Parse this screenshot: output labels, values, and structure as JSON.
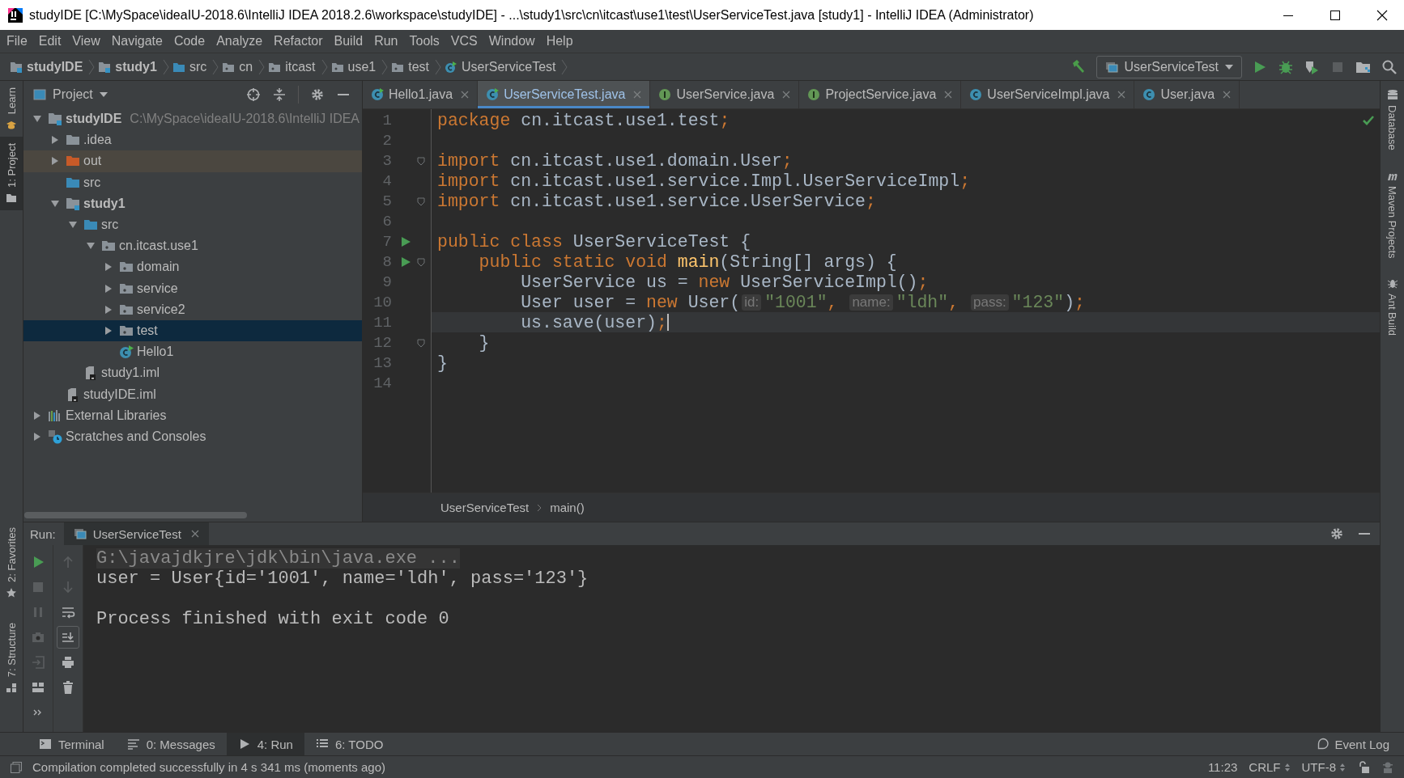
{
  "window": {
    "title": "studyIDE [C:\\MySpace\\ideaIU-2018.6\\IntelliJ IDEA 2018.2.6\\workspace\\studyIDE] - ...\\study1\\src\\cn\\itcast\\use1\\test\\UserServiceTest.java [study1] - IntelliJ IDEA (Administrator)"
  },
  "menu": [
    "File",
    "Edit",
    "View",
    "Navigate",
    "Code",
    "Analyze",
    "Refactor",
    "Build",
    "Run",
    "Tools",
    "VCS",
    "Window",
    "Help"
  ],
  "nav_bar": {
    "crumbs": [
      {
        "label": "studyIDE",
        "kind": "module"
      },
      {
        "label": "study1",
        "kind": "module"
      },
      {
        "label": "src",
        "kind": "source"
      },
      {
        "label": "cn",
        "kind": "package"
      },
      {
        "label": "itcast",
        "kind": "package"
      },
      {
        "label": "use1",
        "kind": "package"
      },
      {
        "label": "test",
        "kind": "package"
      },
      {
        "label": "UserServiceTest",
        "kind": "class-main"
      }
    ],
    "run_config": "UserServiceTest"
  },
  "left_stripe": [
    {
      "label": "Learn",
      "selected": false
    },
    {
      "label": "1: Project",
      "selected": true
    }
  ],
  "left_stripe_bottom": [
    "2: Favorites",
    "7: Structure"
  ],
  "project": {
    "title": "Project",
    "tree": [
      {
        "label": "studyIDE",
        "kind": "module",
        "bold": true,
        "hint": "C:\\MySpace\\ideaIU-2018.6\\IntelliJ IDEA",
        "expanded": true,
        "selected": false,
        "hovered": false,
        "children": [
          {
            "label": ".idea",
            "kind": "folder",
            "expanded": false,
            "selected": false,
            "hovered": false
          },
          {
            "label": "out",
            "kind": "excluded",
            "expanded": false,
            "selected": false,
            "hovered": true
          },
          {
            "label": "src",
            "kind": "source",
            "selected": false,
            "hovered": false
          },
          {
            "label": "study1",
            "kind": "module",
            "bold": true,
            "expanded": true,
            "selected": false,
            "hovered": false,
            "children": [
              {
                "label": "src",
                "kind": "source",
                "expanded": true,
                "selected": false,
                "hovered": false,
                "children": [
                  {
                    "label": "cn.itcast.use1",
                    "kind": "package",
                    "expanded": true,
                    "selected": false,
                    "hovered": false,
                    "children": [
                      {
                        "label": "domain",
                        "kind": "package",
                        "expanded": false,
                        "selected": false,
                        "hovered": false
                      },
                      {
                        "label": "service",
                        "kind": "package",
                        "expanded": false,
                        "selected": false,
                        "hovered": false
                      },
                      {
                        "label": "service2",
                        "kind": "package",
                        "expanded": false,
                        "selected": false,
                        "hovered": false
                      },
                      {
                        "label": "test",
                        "kind": "package",
                        "expanded": false,
                        "selected": true,
                        "hovered": false
                      },
                      {
                        "label": "Hello1",
                        "kind": "class-main",
                        "selected": false,
                        "hovered": false
                      }
                    ]
                  }
                ]
              },
              {
                "label": "study1.iml",
                "kind": "module-file",
                "selected": false,
                "hovered": false
              }
            ]
          },
          {
            "label": "studyIDE.iml",
            "kind": "module-file",
            "selected": false,
            "hovered": false
          }
        ]
      },
      {
        "label": "External Libraries",
        "kind": "libraries",
        "expanded": false,
        "selected": false,
        "hovered": false
      },
      {
        "label": "Scratches and Consoles",
        "kind": "scratches",
        "expanded": false,
        "selected": false,
        "hovered": false
      }
    ]
  },
  "editor": {
    "tabs": [
      {
        "label": "Hello1.java",
        "kind": "class-main",
        "selected": false
      },
      {
        "label": "UserServiceTest.java",
        "kind": "class-main",
        "selected": true
      },
      {
        "label": "UserService.java",
        "kind": "interface",
        "selected": false
      },
      {
        "label": "ProjectService.java",
        "kind": "interface",
        "selected": false
      },
      {
        "label": "UserServiceImpl.java",
        "kind": "class",
        "selected": false
      },
      {
        "label": "User.java",
        "kind": "class",
        "selected": false
      }
    ],
    "lines": [
      {
        "number": "1",
        "tokens": [
          {
            "kind": "kw",
            "text": "package"
          },
          {
            "kind": "plain",
            "text": " cn.itcast.use1.test"
          },
          {
            "kind": "kw",
            "text": ";"
          }
        ]
      },
      {
        "number": "2"
      },
      {
        "number": "3",
        "fold": true,
        "tokens": [
          {
            "kind": "kw",
            "text": "import"
          },
          {
            "kind": "plain",
            "text": " cn.itcast.use1.domain.User"
          },
          {
            "kind": "kw",
            "text": ";"
          }
        ]
      },
      {
        "number": "4",
        "tokens": [
          {
            "kind": "kw",
            "text": "import"
          },
          {
            "kind": "plain",
            "text": " cn.itcast.use1.service.Impl.UserServiceImpl"
          },
          {
            "kind": "kw",
            "text": ";"
          }
        ]
      },
      {
        "number": "5",
        "fold": true,
        "tokens": [
          {
            "kind": "kw",
            "text": "import"
          },
          {
            "kind": "plain",
            "text": " cn.itcast.use1.service.UserService"
          },
          {
            "kind": "kw",
            "text": ";"
          }
        ]
      },
      {
        "number": "6"
      },
      {
        "number": "7",
        "run": true,
        "tokens": [
          {
            "kind": "kw",
            "text": "public class"
          },
          {
            "kind": "plain",
            "text": " UserServiceTest {"
          }
        ]
      },
      {
        "number": "8",
        "run": true,
        "fold": true,
        "tokens": [
          {
            "kind": "kw",
            "text": "    public static void "
          },
          {
            "kind": "method",
            "text": "main"
          },
          {
            "kind": "plain",
            "text": "(String[] args) {"
          }
        ]
      },
      {
        "number": "9",
        "tokens": [
          {
            "kind": "plain",
            "text": "        UserService us = "
          },
          {
            "kind": "kw",
            "text": "new"
          },
          {
            "kind": "plain",
            "text": " UserServiceImpl()"
          },
          {
            "kind": "kw",
            "text": ";"
          }
        ]
      },
      {
        "number": "10",
        "tokens": [
          {
            "kind": "plain",
            "text": "        User user = "
          },
          {
            "kind": "kw",
            "text": "new"
          },
          {
            "kind": "plain",
            "text": " User("
          },
          {
            "kind": "hint",
            "text": "id:"
          },
          {
            "kind": "str",
            "text": "\"1001\""
          },
          {
            "kind": "kw",
            "text": ", "
          },
          {
            "kind": "hint",
            "text": "name:"
          },
          {
            "kind": "str",
            "text": "\"ldh\""
          },
          {
            "kind": "kw",
            "text": ", "
          },
          {
            "kind": "hint",
            "text": "pass:"
          },
          {
            "kind": "str",
            "text": "\"123\""
          },
          {
            "kind": "plain",
            "text": ")"
          },
          {
            "kind": "kw",
            "text": ";"
          }
        ]
      },
      {
        "number": "11",
        "current": true,
        "caret": true,
        "tokens": [
          {
            "kind": "plain",
            "text": "        us.save(user)"
          },
          {
            "kind": "kw",
            "text": ";"
          }
        ]
      },
      {
        "number": "12",
        "fold": true,
        "tokens": [
          {
            "kind": "plain",
            "text": "    }"
          }
        ]
      },
      {
        "number": "13",
        "tokens": [
          {
            "kind": "plain",
            "text": "}"
          }
        ]
      },
      {
        "number": "14"
      }
    ],
    "breadcrumb": [
      "UserServiceTest",
      "main()"
    ]
  },
  "right_stripe": [
    {
      "label": "Database",
      "kind": "database"
    },
    {
      "label": "Maven Projects",
      "kind": "maven"
    },
    {
      "label": "Ant Build",
      "kind": "ant"
    }
  ],
  "run_panel": {
    "label": "Run:",
    "tab": "UserServiceTest",
    "console": [
      {
        "kind": "command",
        "text": "G:\\javajdkjre\\jdk\\bin\\java.exe ..."
      },
      {
        "kind": "output",
        "text": "user = User{id='1001', name='ldh', pass='123'}"
      },
      {
        "kind": "exit",
        "text": "Process finished with exit code 0"
      }
    ]
  },
  "tool_tabs": [
    {
      "label": "Terminal",
      "kind": "terminal",
      "selected": false
    },
    {
      "label": "0: Messages",
      "kind": "messages",
      "selected": false
    },
    {
      "label": "4: Run",
      "kind": "run",
      "selected": true
    },
    {
      "label": "6: TODO",
      "kind": "todo",
      "selected": false
    }
  ],
  "event_log": "Event Log",
  "status_bar": {
    "message": "Compilation completed successfully in 4 s 341 ms (moments ago)",
    "position": "11:23",
    "line_separator": "CRLF",
    "encoding": "UTF-8"
  }
}
